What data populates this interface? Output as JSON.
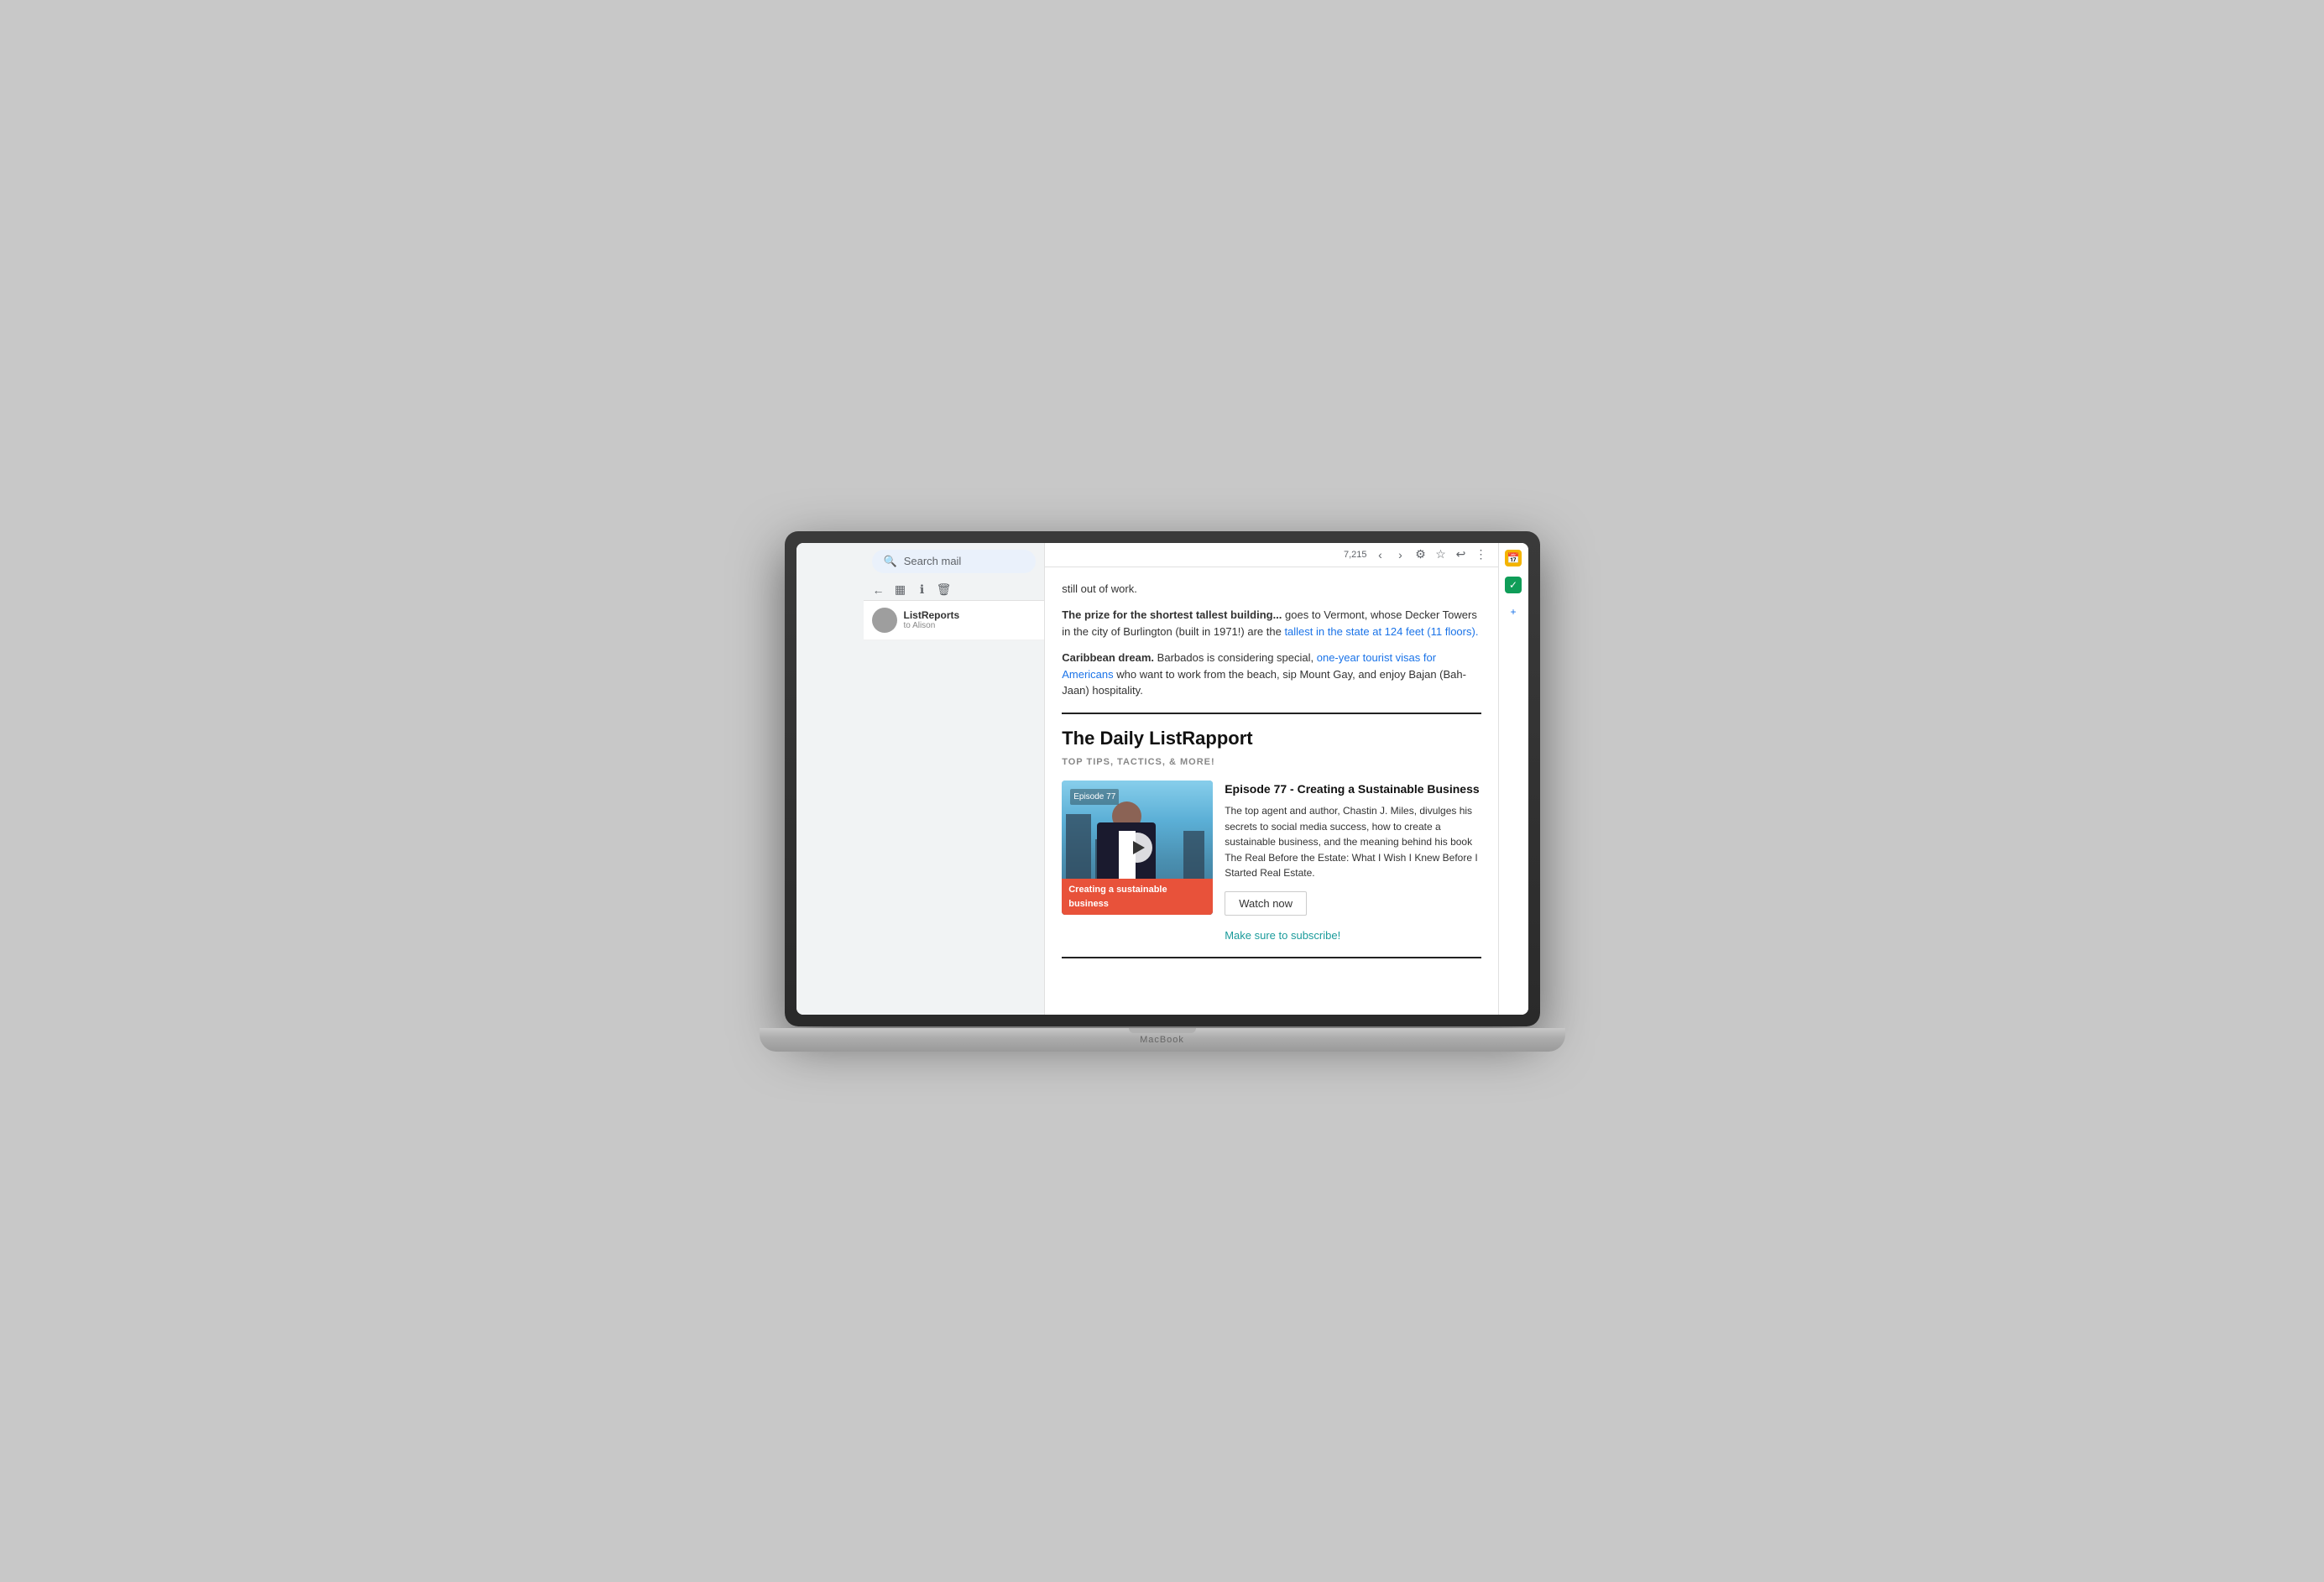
{
  "macbook": {
    "brand_label": "MacBook"
  },
  "gmail": {
    "search_placeholder": "Search mail",
    "count_text": "7,215",
    "email_list": {
      "sender": "ListReports",
      "recipient": "to Alison"
    }
  },
  "email_content": {
    "paragraph1": "still out of work.",
    "paragraph2_bold": "The prize for the shortest tallest building...",
    "paragraph2_text": " goes to Vermont, whose Decker Towers in the city of Burlington (built in 1971!) are the ",
    "paragraph2_link": "tallest in the state at 124 feet (11 floors).",
    "paragraph3_bold": "Caribbean dream.",
    "paragraph3_text": " Barbados is considering special, ",
    "paragraph3_link": "one-year tourist visas for Americans",
    "paragraph3_text2": " who want to work from the beach, sip Mount Gay, and enjoy Bajan (Bah-Jaan) hospitality.",
    "newsletter_title": "The Daily ListRapport",
    "newsletter_subtitle": "TOP TIPS, TACTICS, & MORE!",
    "episode_label": "Episode 77",
    "episode_overlay_text": "Creating a sustainable business",
    "episode_heading": "Episode 77 - Creating a Sustainable Business",
    "episode_description": "The top agent and author, Chastin J. Miles, divulges his secrets to social media success, how to create a sustainable business, and the meaning behind his book The Real Before the Estate: What I Wish I Knew Before I Started Real Estate.",
    "watch_now_label": "Watch now",
    "subscribe_link": "Make sure to subscribe!"
  },
  "icons": {
    "search": "🔍",
    "back": "←",
    "archive": "▦",
    "report": "ℹ",
    "delete": "🗑",
    "star": "☆",
    "reply": "↩",
    "more": "⋮",
    "settings": "⚙",
    "forward": "→",
    "yellow_icon": "📅",
    "blue_check": "✓",
    "plus": "+"
  }
}
